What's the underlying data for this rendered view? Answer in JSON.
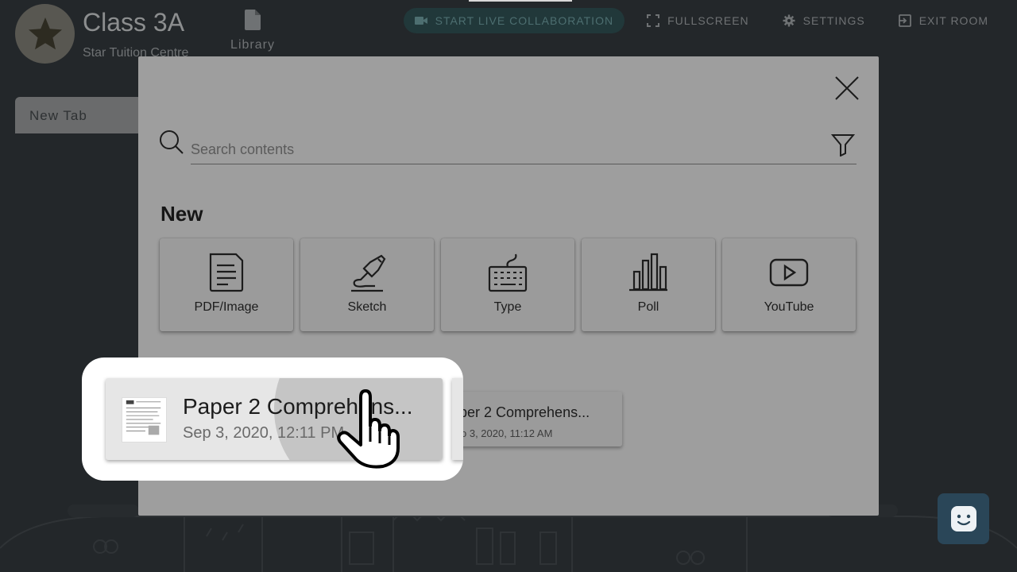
{
  "room": {
    "title": "Class 3A",
    "subtitle": "Star Tuition Centre"
  },
  "nav": {
    "library_label": "Library"
  },
  "topbar": {
    "live_label": "START LIVE COLLABORATION",
    "fullscreen_label": "FULLSCREEN",
    "settings_label": "SETTINGS",
    "exit_label": "EXIT ROOM"
  },
  "tabs": {
    "new_tab_label": "New Tab"
  },
  "modal": {
    "search_placeholder": "Search contents",
    "new_heading": "New",
    "new_items": [
      {
        "label": "PDF/Image",
        "icon": "document-icon"
      },
      {
        "label": "Sketch",
        "icon": "pen-icon"
      },
      {
        "label": "Type",
        "icon": "keyboard-icon"
      },
      {
        "label": "Poll",
        "icon": "bar-chart-icon"
      },
      {
        "label": "YouTube",
        "icon": "play-icon"
      }
    ],
    "recent_items": [
      {
        "name": "Paper 2 Comprehens...",
        "date": "Sep 3, 2020, 12:11 PM"
      },
      {
        "name": "per 2 Comprehens...",
        "date": "o 3, 2020, 11:12 AM"
      }
    ]
  },
  "colors": {
    "background": "#23272a",
    "modal": "#9e9e9e",
    "chat_button": "#2a4658"
  }
}
